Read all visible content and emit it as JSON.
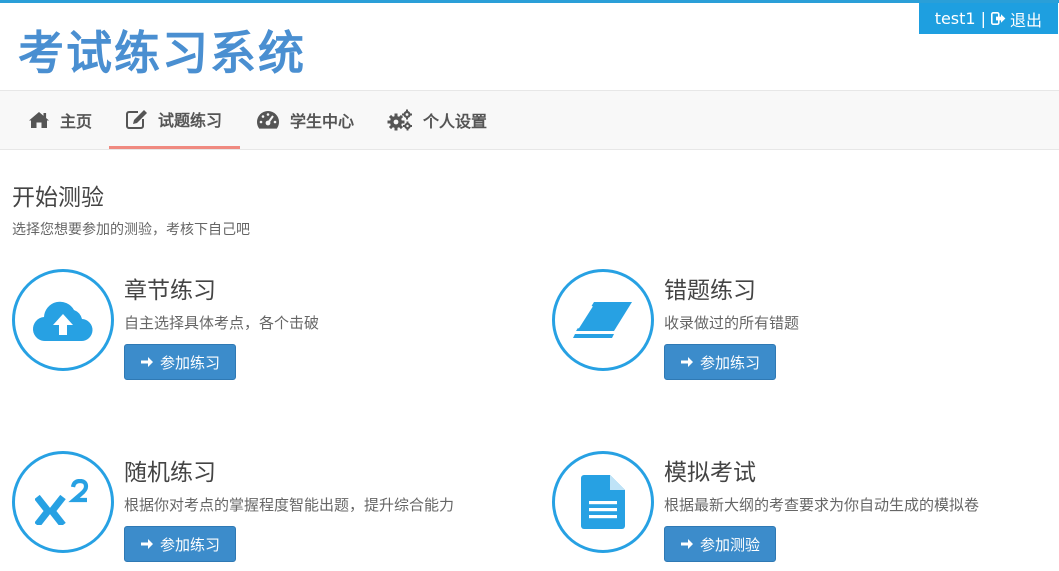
{
  "app": {
    "title": "考试练习系统"
  },
  "user": {
    "name": "test1",
    "separator": "|",
    "logout_label": "退出"
  },
  "nav": {
    "items": [
      {
        "label": "主页",
        "icon": "home-icon",
        "active": false
      },
      {
        "label": "试题练习",
        "icon": "edit-icon",
        "active": true
      },
      {
        "label": "学生中心",
        "icon": "dashboard-icon",
        "active": false
      },
      {
        "label": "个人设置",
        "icon": "gears-icon",
        "active": false
      }
    ]
  },
  "main": {
    "title": "开始测验",
    "subtitle": "选择您想要参加的测验，考核下自己吧",
    "cards": [
      {
        "title": "章节练习",
        "desc": "自主选择具体考点，各个击破",
        "button": "参加练习",
        "icon": "cloud-upload-icon"
      },
      {
        "title": "错题练习",
        "desc": "收录做过的所有错题",
        "button": "参加练习",
        "icon": "eraser-icon"
      },
      {
        "title": "随机练习",
        "desc": "根据你对考点的掌握程度智能出题，提升综合能力",
        "button": "参加练习",
        "icon": "superscript-icon"
      },
      {
        "title": "模拟考试",
        "desc": "根据最新大纲的考查要求为你自动生成的模拟卷",
        "button": "参加测验",
        "icon": "file-text-icon"
      }
    ]
  },
  "colors": {
    "accent": "#1e9fe0",
    "title_blue": "#4a8fd1",
    "button": "#3c8ccb",
    "active_tab": "#f08a80"
  }
}
